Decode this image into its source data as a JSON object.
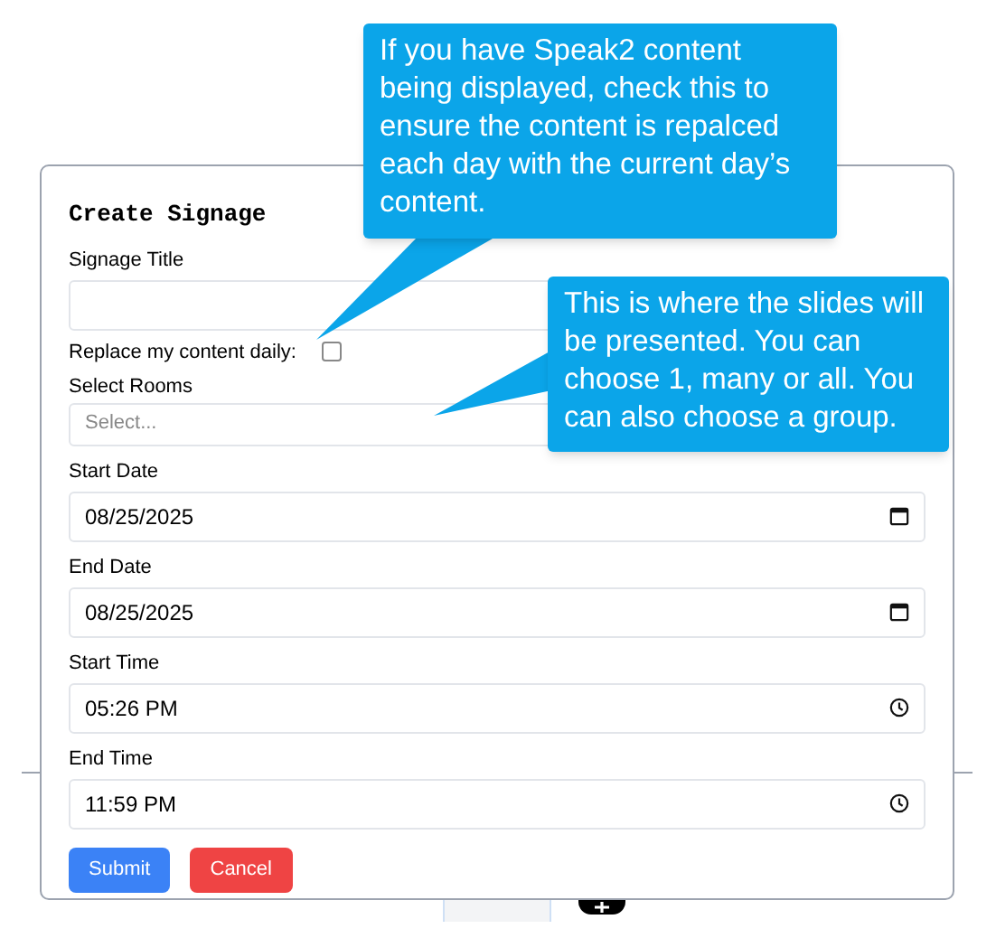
{
  "dialog": {
    "title": "Create Signage",
    "fields": [
      {
        "kind": "text",
        "label": "Signage Title"
      },
      {
        "kind": "checkbox",
        "label": "Replace my content daily:",
        "checked": false
      },
      {
        "kind": "select",
        "label": "Select Rooms",
        "placeholder": "Select..."
      },
      {
        "kind": "date",
        "label": "Start Date",
        "value": "08/25/2025"
      },
      {
        "kind": "date",
        "label": "End Date",
        "value": "08/25/2025"
      },
      {
        "kind": "time",
        "label": "Start Time",
        "value": "05:26 PM"
      },
      {
        "kind": "time",
        "label": "End Time",
        "value": "11:59 PM"
      }
    ],
    "buttons": [
      {
        "label": "Submit",
        "kind": "primary"
      },
      {
        "label": "Cancel",
        "kind": "danger"
      }
    ]
  },
  "callouts": [
    "If you have Speak2 content being displayed, check this to ensure the content is repalced each day with the current day’s content.",
    "This is where the slides will be presented. You can choose 1, many or all. You can also choose a group."
  ]
}
